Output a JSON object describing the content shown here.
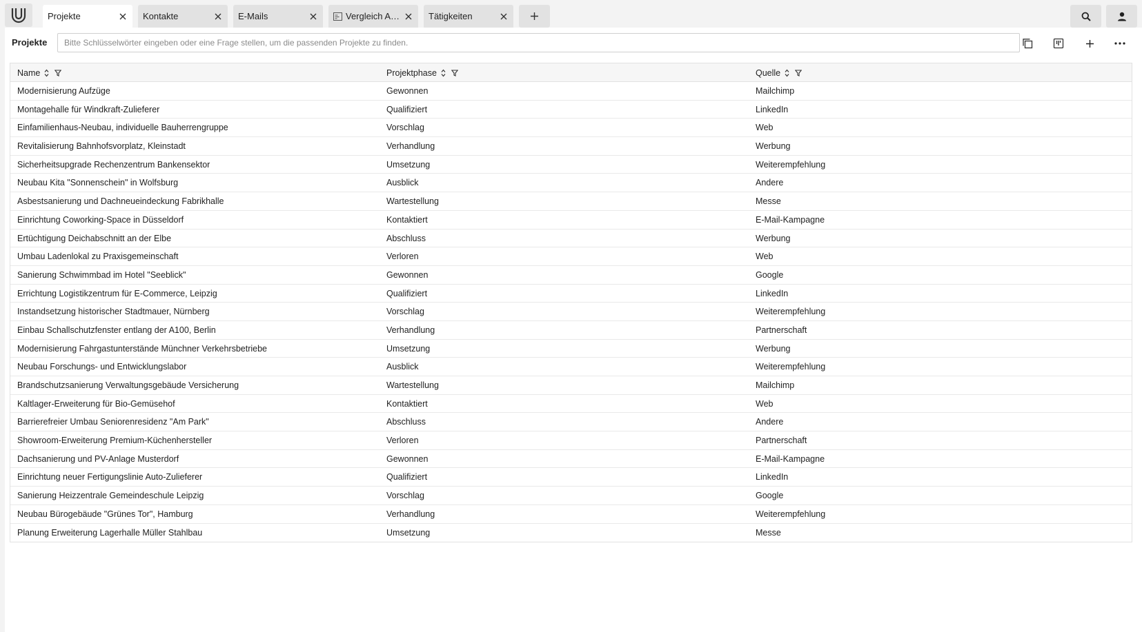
{
  "tabs": [
    {
      "label": "Projekte",
      "active": true
    },
    {
      "label": "Kontakte",
      "active": false
    },
    {
      "label": "E-Mails",
      "active": false
    },
    {
      "label": "Vergleich Ang...",
      "active": false,
      "icon": "document-compare-icon"
    },
    {
      "label": "Tätigkeiten",
      "active": false
    }
  ],
  "toolbar": {
    "title": "Projekte",
    "search_placeholder": "Bitte Schlüsselwörter eingeben oder eine Frage stellen, um die passenden Projekte zu finden.",
    "search_value": ""
  },
  "table": {
    "columns": [
      "Name",
      "Projektphase",
      "Quelle"
    ],
    "rows": [
      [
        "Modernisierung Aufzüge",
        "Gewonnen",
        "Mailchimp"
      ],
      [
        "Montagehalle für Windkraft-Zulieferer",
        "Qualifiziert",
        "LinkedIn"
      ],
      [
        "Einfamilienhaus-Neubau, individuelle Bauherrengruppe",
        "Vorschlag",
        "Web"
      ],
      [
        "Revitalisierung Bahnhofsvorplatz, Kleinstadt",
        "Verhandlung",
        "Werbung"
      ],
      [
        "Sicherheitsupgrade Rechenzentrum Bankensektor",
        "Umsetzung",
        "Weiterempfehlung"
      ],
      [
        "Neubau Kita \"Sonnenschein\" in Wolfsburg",
        "Ausblick",
        "Andere"
      ],
      [
        "Asbestsanierung und Dachneueindeckung Fabrikhalle",
        "Wartestellung",
        "Messe"
      ],
      [
        "Einrichtung Coworking-Space in Düsseldorf",
        "Kontaktiert",
        "E-Mail-Kampagne"
      ],
      [
        "Ertüchtigung Deichabschnitt an der Elbe",
        "Abschluss",
        "Werbung"
      ],
      [
        "Umbau Ladenlokal zu Praxisgemeinschaft",
        "Verloren",
        "Web"
      ],
      [
        "Sanierung Schwimmbad im Hotel \"Seeblick\"",
        "Gewonnen",
        "Google"
      ],
      [
        "Errichtung Logistikzentrum für E-Commerce, Leipzig",
        "Qualifiziert",
        "LinkedIn"
      ],
      [
        "Instandsetzung historischer Stadtmauer, Nürnberg",
        "Vorschlag",
        "Weiterempfehlung"
      ],
      [
        "Einbau Schallschutzfenster entlang der A100, Berlin",
        "Verhandlung",
        "Partnerschaft"
      ],
      [
        "Modernisierung Fahrgastunterstände Münchner Verkehrsbetriebe",
        "Umsetzung",
        "Werbung"
      ],
      [
        "Neubau Forschungs- und Entwicklungslabor",
        "Ausblick",
        "Weiterempfehlung"
      ],
      [
        "Brandschutzsanierung Verwaltungsgebäude Versicherung",
        "Wartestellung",
        "Mailchimp"
      ],
      [
        "Kaltlager-Erweiterung für Bio-Gemüsehof",
        "Kontaktiert",
        "Web"
      ],
      [
        "Barrierefreier Umbau Seniorenresidenz \"Am Park\"",
        "Abschluss",
        "Andere"
      ],
      [
        "Showroom-Erweiterung Premium-Küchenhersteller",
        "Verloren",
        "Partnerschaft"
      ],
      [
        "Dachsanierung und PV-Anlage Musterdorf",
        "Gewonnen",
        "E-Mail-Kampagne"
      ],
      [
        "Einrichtung neuer Fertigungslinie Auto-Zulieferer",
        "Qualifiziert",
        "LinkedIn"
      ],
      [
        "Sanierung Heizzentrale Gemeindeschule Leipzig",
        "Vorschlag",
        "Google"
      ],
      [
        "Neubau Bürogebäude \"Grünes Tor\", Hamburg",
        "Verhandlung",
        "Weiterempfehlung"
      ],
      [
        "Planung Erweiterung Lagerhalle Müller Stahlbau",
        "Umsetzung",
        "Messe"
      ]
    ]
  },
  "icons": {
    "logo": "app-logo-icon",
    "tab_close": "close-icon",
    "add_tab": "plus-icon",
    "search": "search-icon",
    "user": "user-icon",
    "copy": "copy-icon",
    "board": "board-view-icon",
    "add": "plus-icon",
    "more": "more-icon",
    "sort": "sort-icon",
    "filter": "filter-icon"
  },
  "colors": {
    "background": "#f3f3f3",
    "tab_inactive": "#e2e2e2",
    "tab_active": "#ffffff",
    "border": "#e1e1e1"
  }
}
